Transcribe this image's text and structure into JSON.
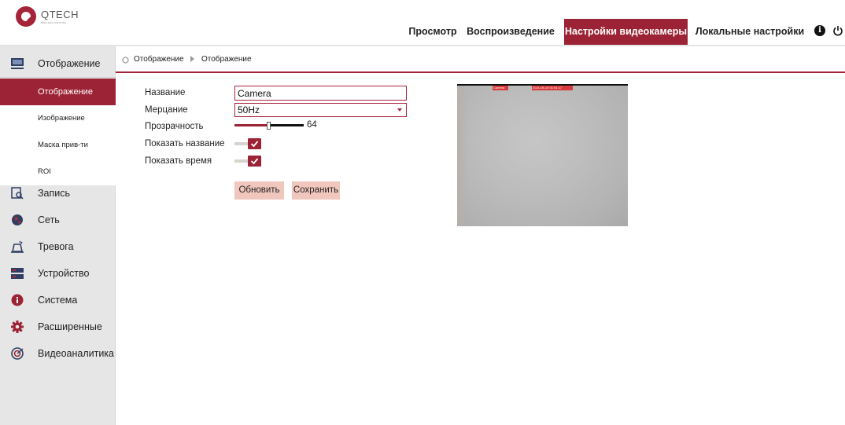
{
  "brand": {
    "name": "QTECH",
    "tagline": "ваш достоинство",
    "accent": "#9b2335"
  },
  "header": {
    "nav": [
      {
        "label": "Просмотр",
        "active": false
      },
      {
        "label": "Воспроизведение",
        "active": false
      },
      {
        "label": "Настройки видеокамеры",
        "active": true
      },
      {
        "label": "Локальные настройки",
        "active": false
      }
    ],
    "icons": [
      "info-icon",
      "power-icon"
    ]
  },
  "sidebar": {
    "top": {
      "label": "Отображение",
      "icon": "monitor-icon"
    },
    "sub_items": [
      {
        "label": "Отображение",
        "active": true
      },
      {
        "label": "Изображение",
        "active": false
      },
      {
        "label": "Маска прив-ти",
        "active": false
      },
      {
        "label": "ROI",
        "active": false
      }
    ],
    "items": [
      {
        "label": "Запись",
        "icon": "record-search-icon"
      },
      {
        "label": "Сеть",
        "icon": "network-globe-icon"
      },
      {
        "label": "Тревога",
        "icon": "alarm-bell-icon"
      },
      {
        "label": "Устройство",
        "icon": "storage-device-icon"
      },
      {
        "label": "Система",
        "icon": "info-icon"
      },
      {
        "label": "Расширенные",
        "icon": "gear-icon"
      },
      {
        "label": "Видеоаналитика",
        "icon": "analytics-icon"
      }
    ]
  },
  "breadcrumb": {
    "section": "Отображение",
    "page": "Отображение"
  },
  "form": {
    "name_label": "Название",
    "name_value": "Camera",
    "flicker_label": "Мерцание",
    "flicker_value": "50Hz",
    "transparency_label": "Прозрачность",
    "transparency_value": "64",
    "transparency_fraction": 0.5,
    "show_name_label": "Показать название",
    "show_name_on": true,
    "show_time_label": "Показать время",
    "show_time_on": true,
    "refresh_label": "Обновить",
    "save_label": "Сохранить"
  },
  "preview": {
    "osd_name": "Camera",
    "osd_time": "2021-05-19 01:51:17"
  }
}
